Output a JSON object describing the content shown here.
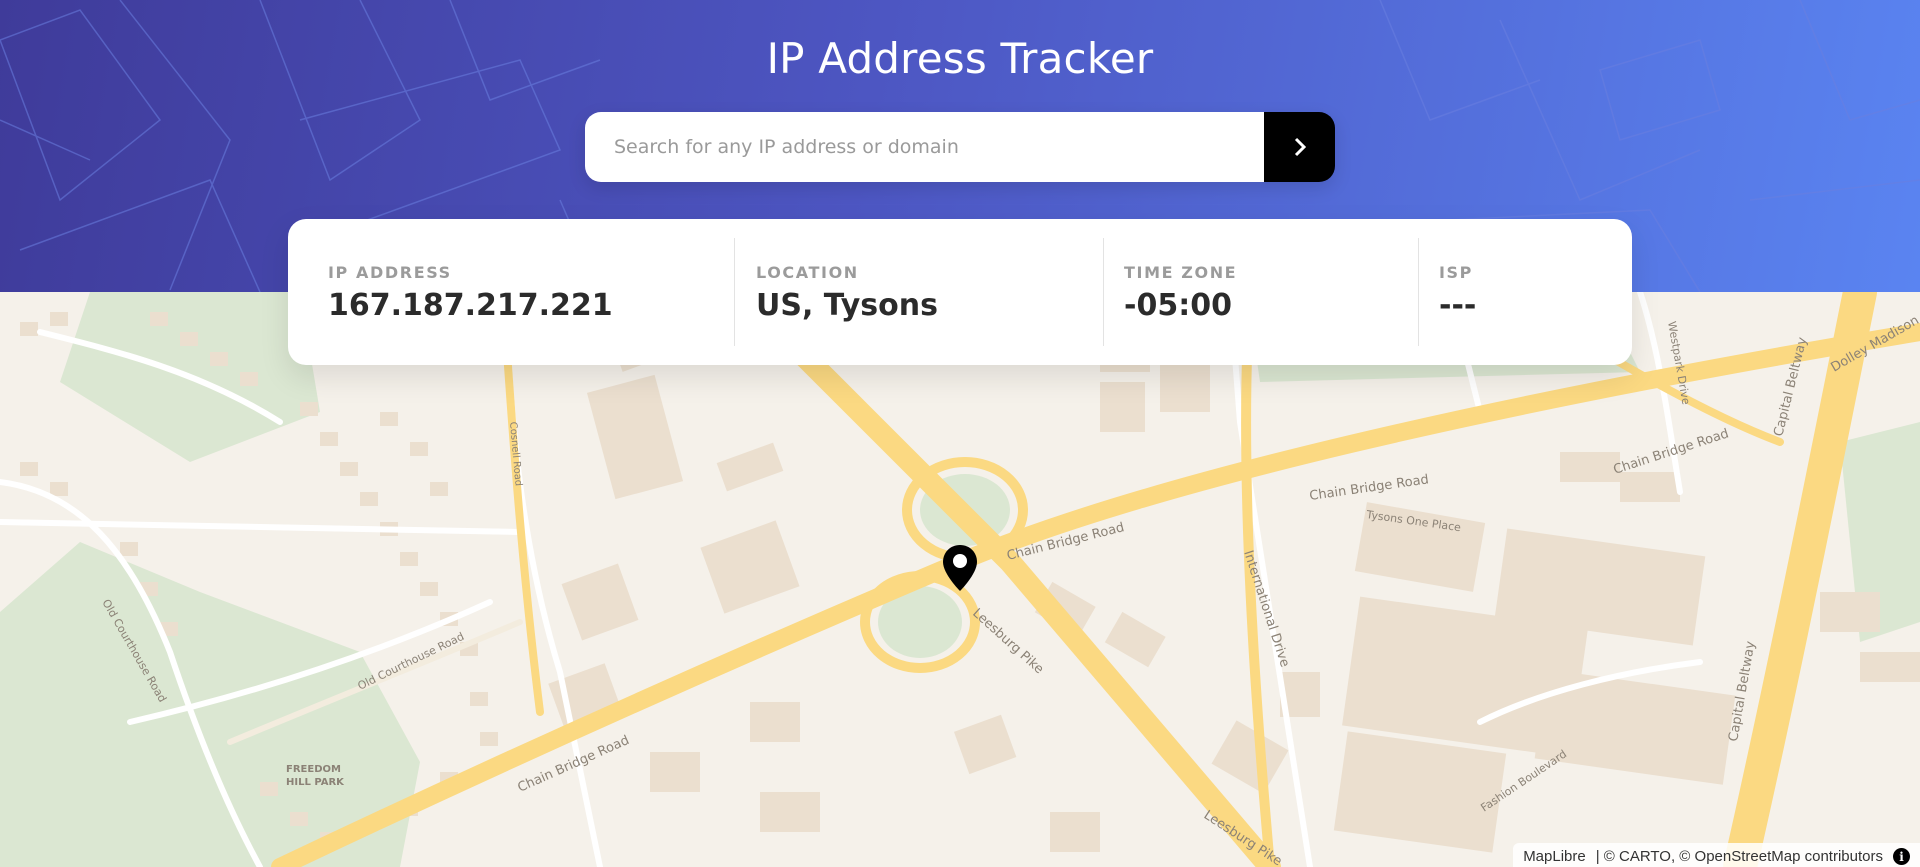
{
  "header": {
    "title": "IP Address Tracker",
    "gradient_colors": [
      "#3f3b9a",
      "#5a84f1"
    ]
  },
  "search": {
    "placeholder": "Search for any IP address or domain",
    "value": "",
    "button_icon": "chevron-right-icon"
  },
  "info": {
    "ip_label": "IP ADDRESS",
    "ip_value": "167.187.217.221",
    "location_label": "LOCATION",
    "location_value": "US, Tysons",
    "timezone_label": "TIME ZONE",
    "timezone_value": "-05:00",
    "isp_label": "ISP",
    "isp_value": "---"
  },
  "map": {
    "marker_icon": "location-pin-icon",
    "labels": {
      "chain_bridge_1": "Chain Bridge Road",
      "chain_bridge_2": "Chain Bridge Road",
      "chain_bridge_3": "Chain Bridge Road",
      "chain_bridge_4": "Chain Bridge Road",
      "leesburg_1": "Leesburg Pike",
      "leesburg_2": "Leesburg Pike",
      "old_courthouse_1": "Old Courthouse Road",
      "old_courthouse_2": "Old Courthouse Road",
      "cosnell": "Cosnell Road",
      "international": "International Drive",
      "tysons_one": "Tysons One Place",
      "capital_1": "Capital Beltway",
      "capital_2": "Capital Beltway",
      "westpark": "Westpark Drive",
      "dolley": "Dolley Madison",
      "fashion": "Fashion Boulevard",
      "park_1": "FREEDOM",
      "park_2": "HILL PARK"
    },
    "attribution": {
      "maplibre": "MapLibre",
      "carto": "| © CARTO, ©",
      "osm": "OpenStreetMap",
      "contributors": "contributors"
    },
    "colors": {
      "land": "#f5f1ea",
      "park": "#d9e6cf",
      "building": "#eadfd0",
      "road_major": "#fbd982",
      "road_minor": "#ffffff"
    }
  }
}
